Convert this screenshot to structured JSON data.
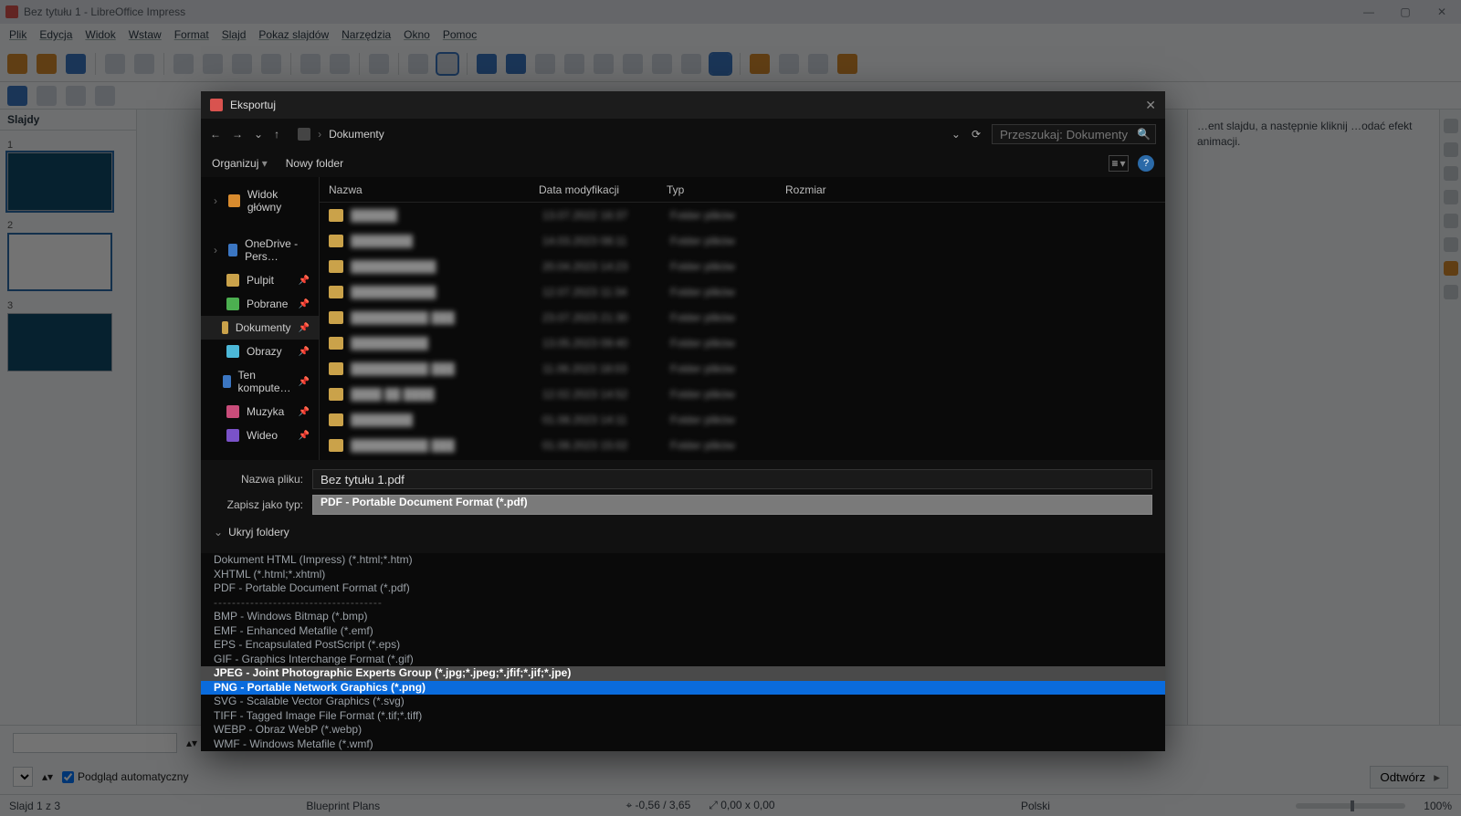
{
  "window": {
    "title": "Bez tytułu 1 - LibreOffice Impress"
  },
  "menu": [
    "Plik",
    "Edycja",
    "Widok",
    "Wstaw",
    "Format",
    "Slajd",
    "Pokaz slajdów",
    "Narzędzia",
    "Okno",
    "Pomoc"
  ],
  "slides_panel_header": "Slajdy",
  "slides": [
    {
      "num": "1",
      "selected": true
    },
    {
      "num": "2",
      "selected": false
    },
    {
      "num": "3",
      "selected": false
    }
  ],
  "right_help": "…ent slajdu, a następnie kliknij …odać efekt animacji.",
  "bottom": {
    "auto_preview_label": "Podgląd automatyczny",
    "auto_preview_checked": true,
    "play_button": "Odtwórz"
  },
  "status": {
    "slide_pos": "Slajd 1 z 3",
    "template": "Blueprint Plans",
    "cursor": "-0,56 / 3,65",
    "size": "0,00 x 0,00",
    "lang": "Polski",
    "zoom": "100%"
  },
  "dialog": {
    "title": "Eksportuj",
    "path_root": "Dokumenty",
    "search_placeholder": "Przeszukaj: Dokumenty",
    "organize": "Organizuj",
    "new_folder": "Nowy folder",
    "sidebar": [
      {
        "ico": "ico-home",
        "label": "Widok główny",
        "chevron": true
      },
      {
        "ico": "ico-cloud",
        "label": "OneDrive - Pers…",
        "chevron": true,
        "gap": true
      },
      {
        "ico": "ico-fold",
        "label": "Pulpit",
        "pin": true
      },
      {
        "ico": "ico-dl",
        "label": "Pobrane",
        "pin": true
      },
      {
        "ico": "ico-fold",
        "label": "Dokumenty",
        "pin": true,
        "active": true
      },
      {
        "ico": "ico-img",
        "label": "Obrazy",
        "pin": true
      },
      {
        "ico": "ico-pc",
        "label": "Ten kompute…",
        "pin": true
      },
      {
        "ico": "ico-mus",
        "label": "Muzyka",
        "pin": true
      },
      {
        "ico": "ico-vid",
        "label": "Wideo",
        "pin": true
      }
    ],
    "columns": {
      "name": "Nazwa",
      "date": "Data modyfikacji",
      "type": "Typ",
      "size": "Rozmiar"
    },
    "rows": [
      {
        "n": "██████",
        "d": "13.07.2022 16:37",
        "t": "Folder plików"
      },
      {
        "n": "████████",
        "d": "14.03.2023 08:11",
        "t": "Folder plików"
      },
      {
        "n": "███████████",
        "d": "20.04.2023 14:23",
        "t": "Folder plików"
      },
      {
        "n": "███████████",
        "d": "12.07.2023 11:34",
        "t": "Folder plików"
      },
      {
        "n": "██████████ ███",
        "d": "23.07.2023 21:30",
        "t": "Folder plików"
      },
      {
        "n": "██████████",
        "d": "13.05.2023 09:40",
        "t": "Folder plików"
      },
      {
        "n": "██████████ ███",
        "d": "11.06.2023 18:03",
        "t": "Folder plików"
      },
      {
        "n": "████ ██ ████",
        "d": "12.02.2023 14:52",
        "t": "Folder plików"
      },
      {
        "n": "████████",
        "d": "01.08.2023 14:11",
        "t": "Folder plików"
      },
      {
        "n": "██████████ ███",
        "d": "01.08.2023 15:02",
        "t": "Folder plików"
      }
    ],
    "filename_label": "Nazwa pliku:",
    "filename_value": "Bez tytułu 1.pdf",
    "type_label": "Zapisz jako typ:",
    "type_selected": "PDF - Portable Document Format (*.pdf)",
    "hide_folders": "Ukryj foldery",
    "options": [
      {
        "txt": "Dokument HTML (Impress) (*.html;*.htm)"
      },
      {
        "txt": "XHTML (*.html;*.xhtml)"
      },
      {
        "txt": "PDF - Portable Document Format (*.pdf)"
      },
      {
        "txt": "-------------------------------------",
        "sep": true
      },
      {
        "txt": "BMP - Windows Bitmap (*.bmp)"
      },
      {
        "txt": "EMF - Enhanced Metafile (*.emf)"
      },
      {
        "txt": "EPS - Encapsulated PostScript (*.eps)"
      },
      {
        "txt": "GIF - Graphics Interchange Format (*.gif)"
      },
      {
        "txt": "JPEG - Joint Photographic Experts Group (*.jpg;*.jpeg;*.jfif;*.jif;*.jpe)",
        "hov": true
      },
      {
        "txt": "PNG - Portable Network Graphics (*.png)",
        "sel": true
      },
      {
        "txt": "SVG - Scalable Vector Graphics (*.svg)"
      },
      {
        "txt": "TIFF - Tagged Image File Format (*.tif;*.tiff)"
      },
      {
        "txt": "WEBP - Obraz WebP (*.webp)"
      },
      {
        "txt": "WMF - Windows Metafile (*.wmf)"
      }
    ]
  }
}
